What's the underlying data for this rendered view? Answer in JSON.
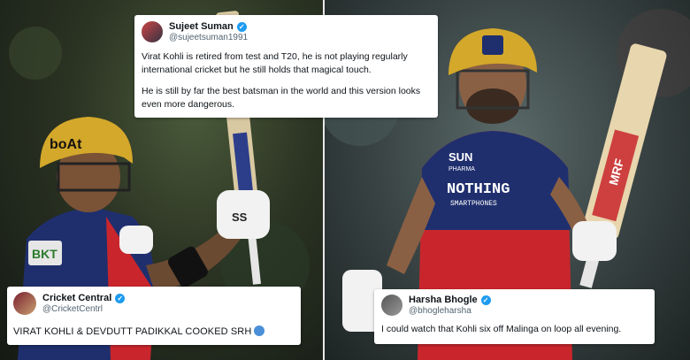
{
  "tweets": [
    {
      "name": "Sujeet Suman",
      "handle": "@sujeetsuman1991",
      "paragraphs": [
        "Virat Kohli is retired from test and T20, he is not playing regularly international cricket but he still holds that magical touch.",
        "He is still by far the best batsman in the world and this version looks even more dangerous."
      ]
    },
    {
      "name": "Cricket Central",
      "handle": "@CricketCentrl",
      "text": "VIRAT KOHLI & DEVDUTT PADIKKAL COOKED SRH"
    },
    {
      "name": "Harsha Bhogle",
      "handle": "@bhogleharsha",
      "text": "I could watch that Kohli six off Malinga on loop all evening."
    }
  ],
  "left_photo": {
    "helmet_brand": "boAt",
    "jersey_sponsor": "BKT",
    "glove_brand": "SS"
  },
  "right_photo": {
    "jersey_text_1": "SUN",
    "jersey_text_2": "PHARMA",
    "jersey_text_3": "NOTHING",
    "jersey_text_4": "SMARTPHONES",
    "bat_brand": "MRF"
  },
  "colors": {
    "verified": "#1d9bf0",
    "jersey_navy": "#1f2f6e",
    "jersey_red": "#c8262c",
    "helmet_gold": "#d4a82a"
  }
}
